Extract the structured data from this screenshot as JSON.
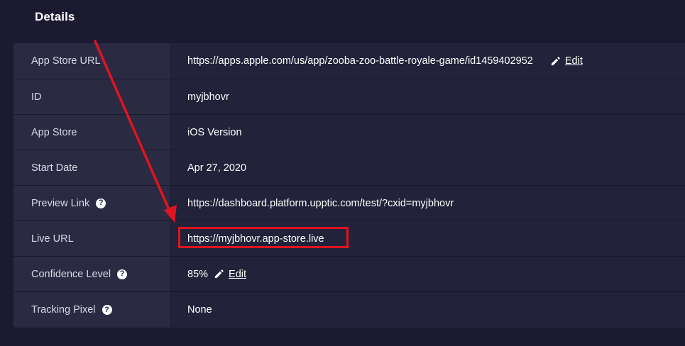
{
  "section": {
    "title": "Details"
  },
  "rows": [
    {
      "label": "App Store URL",
      "value": "https://apps.apple.com/us/app/zooba-zoo-battle-royale-game/id1459402952",
      "edit_label": "Edit"
    },
    {
      "label": "ID",
      "value": "myjbhovr"
    },
    {
      "label": "App Store",
      "value": "iOS Version"
    },
    {
      "label": "Start Date",
      "value": "Apr 27, 2020"
    },
    {
      "label": "Preview Link",
      "value": "https://dashboard.platform.upptic.com/test/?cxid=myjbhovr",
      "help": "?"
    },
    {
      "label": "Live URL",
      "value": "https://myjbhovr.app-store.live"
    },
    {
      "label": "Confidence Level",
      "value": "85%",
      "help": "?",
      "edit_label": "Edit"
    },
    {
      "label": "Tracking Pixel",
      "value": "None",
      "help": "?"
    }
  ],
  "annotation": {
    "color": "#e0141e",
    "icon": "red-arrow-icon"
  }
}
